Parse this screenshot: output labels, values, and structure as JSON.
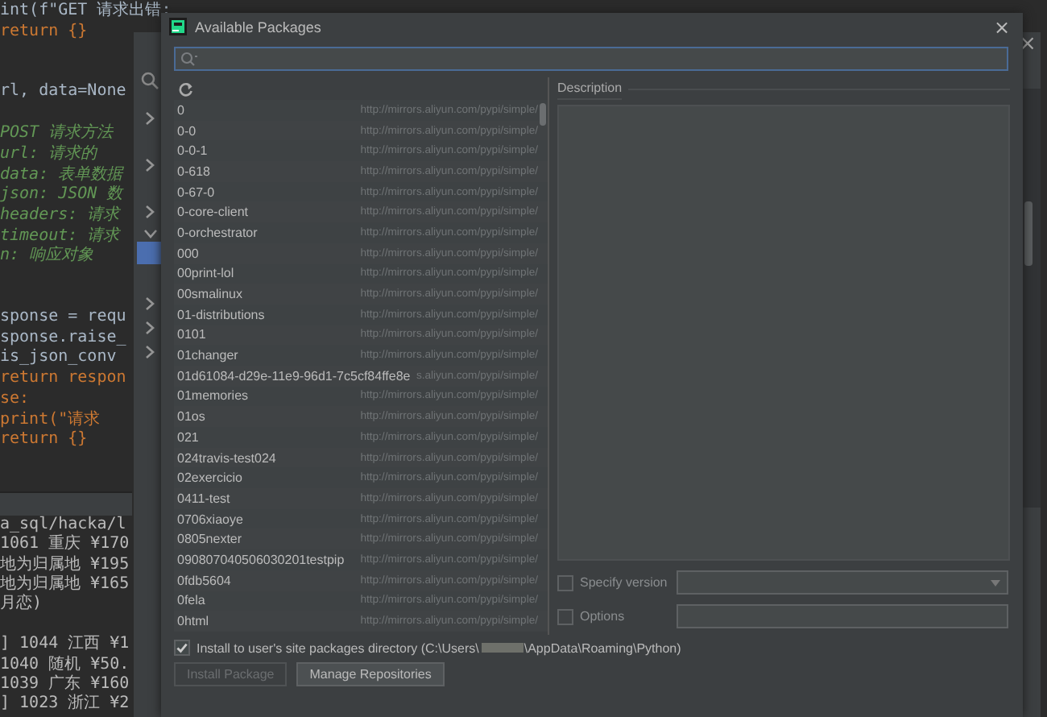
{
  "editor": {
    "code_lines": [
      {
        "text": "int(f\"GET 请求出错:",
        "kind": "code"
      },
      {
        "text": "return {}",
        "kind": "keyword"
      },
      {
        "text": "rl, data=None",
        "kind": "code"
      },
      {
        "text": "POST 请求方法",
        "kind": "comment"
      },
      {
        "text": "url: 请求的",
        "kind": "comment"
      },
      {
        "text": "data: 表单数据",
        "kind": "comment"
      },
      {
        "text": "json: JSON 数",
        "kind": "comment"
      },
      {
        "text": "headers: 请求",
        "kind": "comment"
      },
      {
        "text": "timeout: 请求",
        "kind": "comment"
      },
      {
        "text": "n: 响应对象",
        "kind": "comment"
      },
      {
        "text": "sponse = requ",
        "kind": "code"
      },
      {
        "text": "sponse.raise_",
        "kind": "code"
      },
      {
        "text": "is_json_conv",
        "kind": "code"
      },
      {
        "text": "return respon",
        "kind": "keyword"
      },
      {
        "text": "se:",
        "kind": "keyword"
      },
      {
        "text": "print(\"请求",
        "kind": "keyword"
      },
      {
        "text": "return {}",
        "kind": "keyword"
      }
    ],
    "console_lines": [
      "a_sql/hacka/l",
      "1061 重庆 ¥170",
      "地为归属地 ¥195",
      "地为归属地 ¥165",
      "月恋)",
      "] 1044 江西 ¥1",
      "1040 随机 ¥50.",
      "1039 广东 ¥160",
      "] 1023 浙江 ¥2"
    ]
  },
  "back_dialog": {
    "close": "×"
  },
  "dialog": {
    "title": "Available Packages",
    "close": "×",
    "packages": [
      {
        "name": "0",
        "url": "http://mirrors.aliyun.com/pypi/simple/"
      },
      {
        "name": "0-0",
        "url": "http://mirrors.aliyun.com/pypi/simple/"
      },
      {
        "name": "0-0-1",
        "url": "http://mirrors.aliyun.com/pypi/simple/"
      },
      {
        "name": "0-618",
        "url": "http://mirrors.aliyun.com/pypi/simple/"
      },
      {
        "name": "0-67-0",
        "url": "http://mirrors.aliyun.com/pypi/simple/"
      },
      {
        "name": "0-core-client",
        "url": "http://mirrors.aliyun.com/pypi/simple/"
      },
      {
        "name": "0-orchestrator",
        "url": "http://mirrors.aliyun.com/pypi/simple/"
      },
      {
        "name": "000",
        "url": "http://mirrors.aliyun.com/pypi/simple/"
      },
      {
        "name": "00print-lol",
        "url": "http://mirrors.aliyun.com/pypi/simple/"
      },
      {
        "name": "00smalinux",
        "url": "http://mirrors.aliyun.com/pypi/simple/"
      },
      {
        "name": "01-distributions",
        "url": "http://mirrors.aliyun.com/pypi/simple/"
      },
      {
        "name": "0101",
        "url": "http://mirrors.aliyun.com/pypi/simple/"
      },
      {
        "name": "01changer",
        "url": "http://mirrors.aliyun.com/pypi/simple/"
      },
      {
        "name": "01d61084-d29e-11e9-96d1-7c5cf84ffe8e",
        "url": "s.aliyun.com/pypi/simple/"
      },
      {
        "name": "01memories",
        "url": "http://mirrors.aliyun.com/pypi/simple/"
      },
      {
        "name": "01os",
        "url": "http://mirrors.aliyun.com/pypi/simple/"
      },
      {
        "name": "021",
        "url": "http://mirrors.aliyun.com/pypi/simple/"
      },
      {
        "name": "024travis-test024",
        "url": "http://mirrors.aliyun.com/pypi/simple/"
      },
      {
        "name": "02exercicio",
        "url": "http://mirrors.aliyun.com/pypi/simple/"
      },
      {
        "name": "0411-test",
        "url": "http://mirrors.aliyun.com/pypi/simple/"
      },
      {
        "name": "0706xiaoye",
        "url": "http://mirrors.aliyun.com/pypi/simple/"
      },
      {
        "name": "0805nexter",
        "url": "http://mirrors.aliyun.com/pypi/simple/"
      },
      {
        "name": "090807040506030201testpip",
        "url": "http://mirrors.aliyun.com/pypi/simple/"
      },
      {
        "name": "0fdb5604",
        "url": "http://mirrors.aliyun.com/pypi/simple/"
      },
      {
        "name": "0fela",
        "url": "http://mirrors.aliyun.com/pypi/simple/"
      },
      {
        "name": "0html",
        "url": "http://mirrors.aliyun.com/pypi/simple/"
      }
    ],
    "description": {
      "label": "Description"
    },
    "specify_version": {
      "label": "Specify version",
      "checked": false
    },
    "options": {
      "label": "Options",
      "checked": false
    },
    "install_to_user": {
      "label_start": "Install to user's site packages directory (C:\\Users\\",
      "label_end": "\\AppData\\Roaming\\Python)",
      "checked": true
    },
    "buttons": [
      {
        "label": "Install Package",
        "disabled": true
      },
      {
        "label": "Manage Repositories",
        "disabled": false
      }
    ]
  }
}
